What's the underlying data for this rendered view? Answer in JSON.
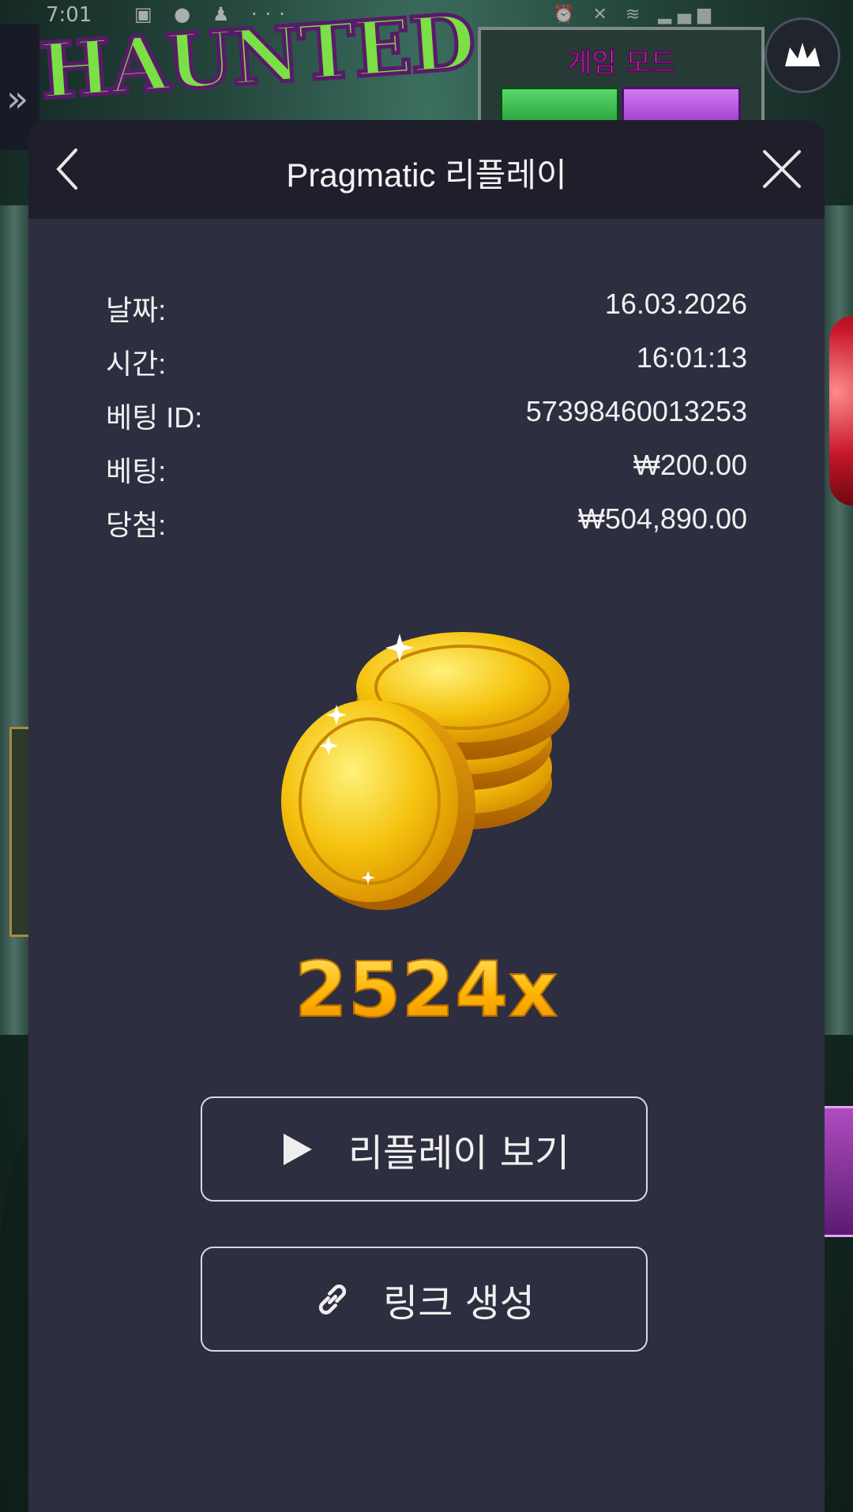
{
  "statusbar": {
    "time": "7:01",
    "icons": "▣ ● ♟ ···",
    "right_icons": "⏰ ✕ ≋ ▂▄▆"
  },
  "game": {
    "logo_text": "HAUNTED",
    "mode_title": "게임 모드"
  },
  "modal": {
    "title": "Pragmatic 리플레이",
    "rows": [
      {
        "label": "날짜:",
        "value": "16.03.2026"
      },
      {
        "label": "시간:",
        "value": "16:01:13"
      },
      {
        "label": "베팅 ID:",
        "value": "57398460013253"
      },
      {
        "label": "베팅:",
        "value": "₩200.00"
      },
      {
        "label": "당첨:",
        "value": "₩504,890.00"
      }
    ],
    "multiplier": "2524x",
    "replay_button": "리플레이 보기",
    "link_button": "링크 생성"
  },
  "icons": {
    "back": "chevron-left-icon",
    "close": "close-icon",
    "play": "play-icon",
    "link": "link-icon",
    "crown": "crown-icon",
    "nav": "double-chevron-right-icon"
  },
  "colors": {
    "modal_bg": "#2d2e3f",
    "header_bg": "#1e1f2b",
    "multiplier_gold": "#ffbf12"
  }
}
